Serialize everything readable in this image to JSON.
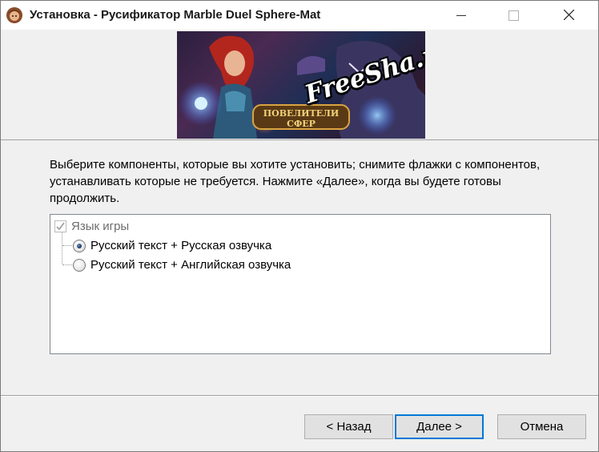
{
  "window": {
    "title": "Установка - Русификатор Marble Duel Sphere-Mat",
    "controls": [
      "minimize-icon",
      "maximize-icon",
      "close-icon"
    ]
  },
  "banner": {
    "watermark": "FreeSha.net",
    "logo_line1": "ПОВЕЛИТЕЛИ",
    "logo_line2": "СФЕР"
  },
  "instructions": "Выберите компоненты, которые вы хотите установить; снимите флажки с компонентов, устанавливать которые не требуется. Нажмите «Далее», когда вы будете готовы продолжить.",
  "components": {
    "root": {
      "label": "Язык игры",
      "checked": true,
      "disabled": true
    },
    "options": [
      {
        "label": "Русский текст + Русская озвучка",
        "selected": true
      },
      {
        "label": "Русский текст + Английская озвучка",
        "selected": false
      }
    ]
  },
  "buttons": {
    "back": "< Назад",
    "next": "Далее >",
    "cancel": "Отмена"
  },
  "colors": {
    "focus_border": "#0078d7",
    "window_bg": "#f0f0f0",
    "button_bg": "#e1e1e1"
  }
}
